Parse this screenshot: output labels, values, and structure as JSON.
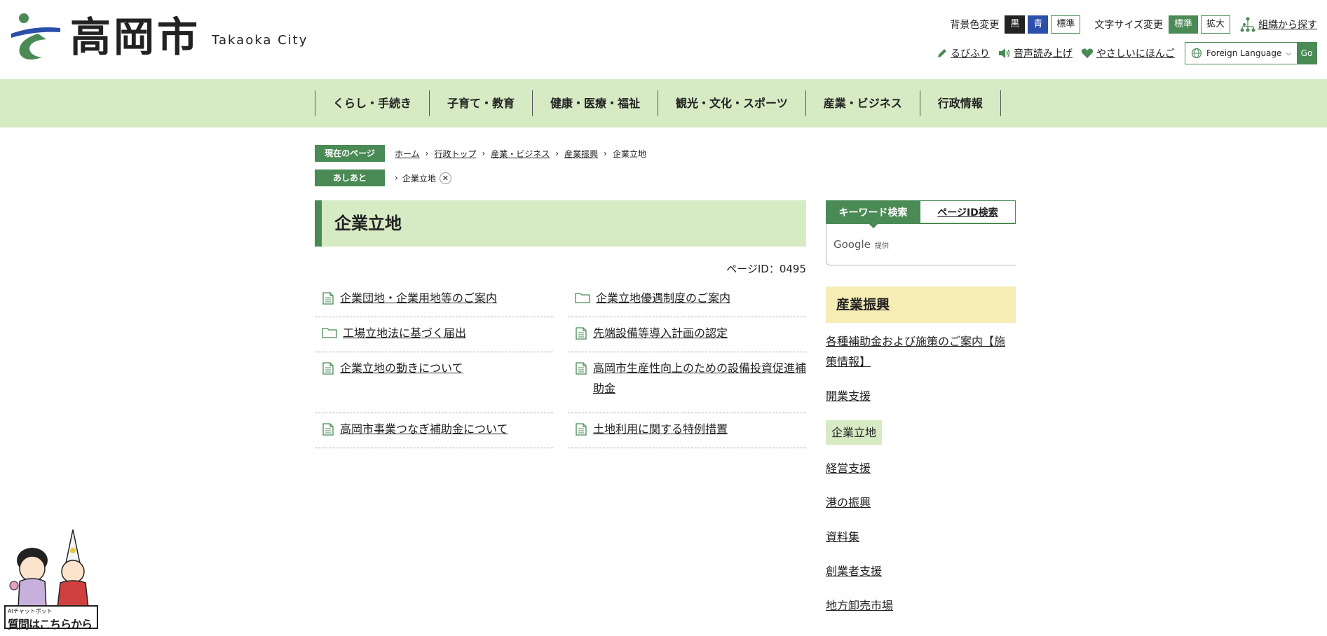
{
  "header": {
    "logo_jp": "高岡市",
    "logo_en": "Takaoka City",
    "bg_label": "背景色変更",
    "bg_black": "黒",
    "bg_blue": "青",
    "bg_standard": "標準",
    "font_label": "文字サイズ変更",
    "font_standard": "標準",
    "font_large": "拡大",
    "org_search": "組織から探す",
    "ruby": "るびふり",
    "read_aloud": "音声読み上げ",
    "easy_japanese": "やさしいにほんご",
    "language_select": "Foreign Language",
    "go": "Go"
  },
  "gnav": [
    "くらし・手続き",
    "子育て・教育",
    "健康・医療・福祉",
    "観光・文化・スポーツ",
    "産業・ビジネス",
    "行政情報"
  ],
  "breadcrumb": {
    "tag": "現在のページ",
    "items": [
      "ホーム",
      "行政トップ",
      "産業・ビジネス",
      "産業振興"
    ],
    "current": "企業立地"
  },
  "footprint": {
    "tag": "あしあと",
    "item": "企業立地",
    "close": "✕"
  },
  "main": {
    "title": "企業立地",
    "page_id": "ページID：0495",
    "links": [
      {
        "label": "企業団地・企業用地等のご案内",
        "icon": "document-icon"
      },
      {
        "label": "企業立地優遇制度のご案内",
        "icon": "folder-icon"
      },
      {
        "label": "工場立地法に基づく届出",
        "icon": "folder-icon"
      },
      {
        "label": "先端設備等導入計画の認定",
        "icon": "document-icon"
      },
      {
        "label": "企業立地の動きについて",
        "icon": "document-icon"
      },
      {
        "label": "高岡市生産性向上のための設備投資促進補助金",
        "icon": "document-icon"
      },
      {
        "label": "高岡市事業つなぎ補助金について",
        "icon": "document-icon"
      },
      {
        "label": "土地利用に関する特例措置",
        "icon": "document-icon"
      }
    ]
  },
  "sidebar": {
    "tab_keyword": "キーワード検索",
    "tab_pageid": "ページID検索",
    "search_google": "Google",
    "search_provided": "提供",
    "section_title": "産業振興",
    "items": [
      "各種補助金および施策のご案内【施策情報】",
      "開業支援",
      "企業立地",
      "経営支援",
      "港の振興",
      "資料集",
      "創業者支援",
      "地方卸売市場"
    ]
  },
  "chatbot": {
    "small": "AIチャットボット",
    "big": "質問はこちらから"
  },
  "colors": {
    "green": "#4a8a55",
    "light_green": "#d6eac4",
    "yellow": "#f6ecb5"
  }
}
